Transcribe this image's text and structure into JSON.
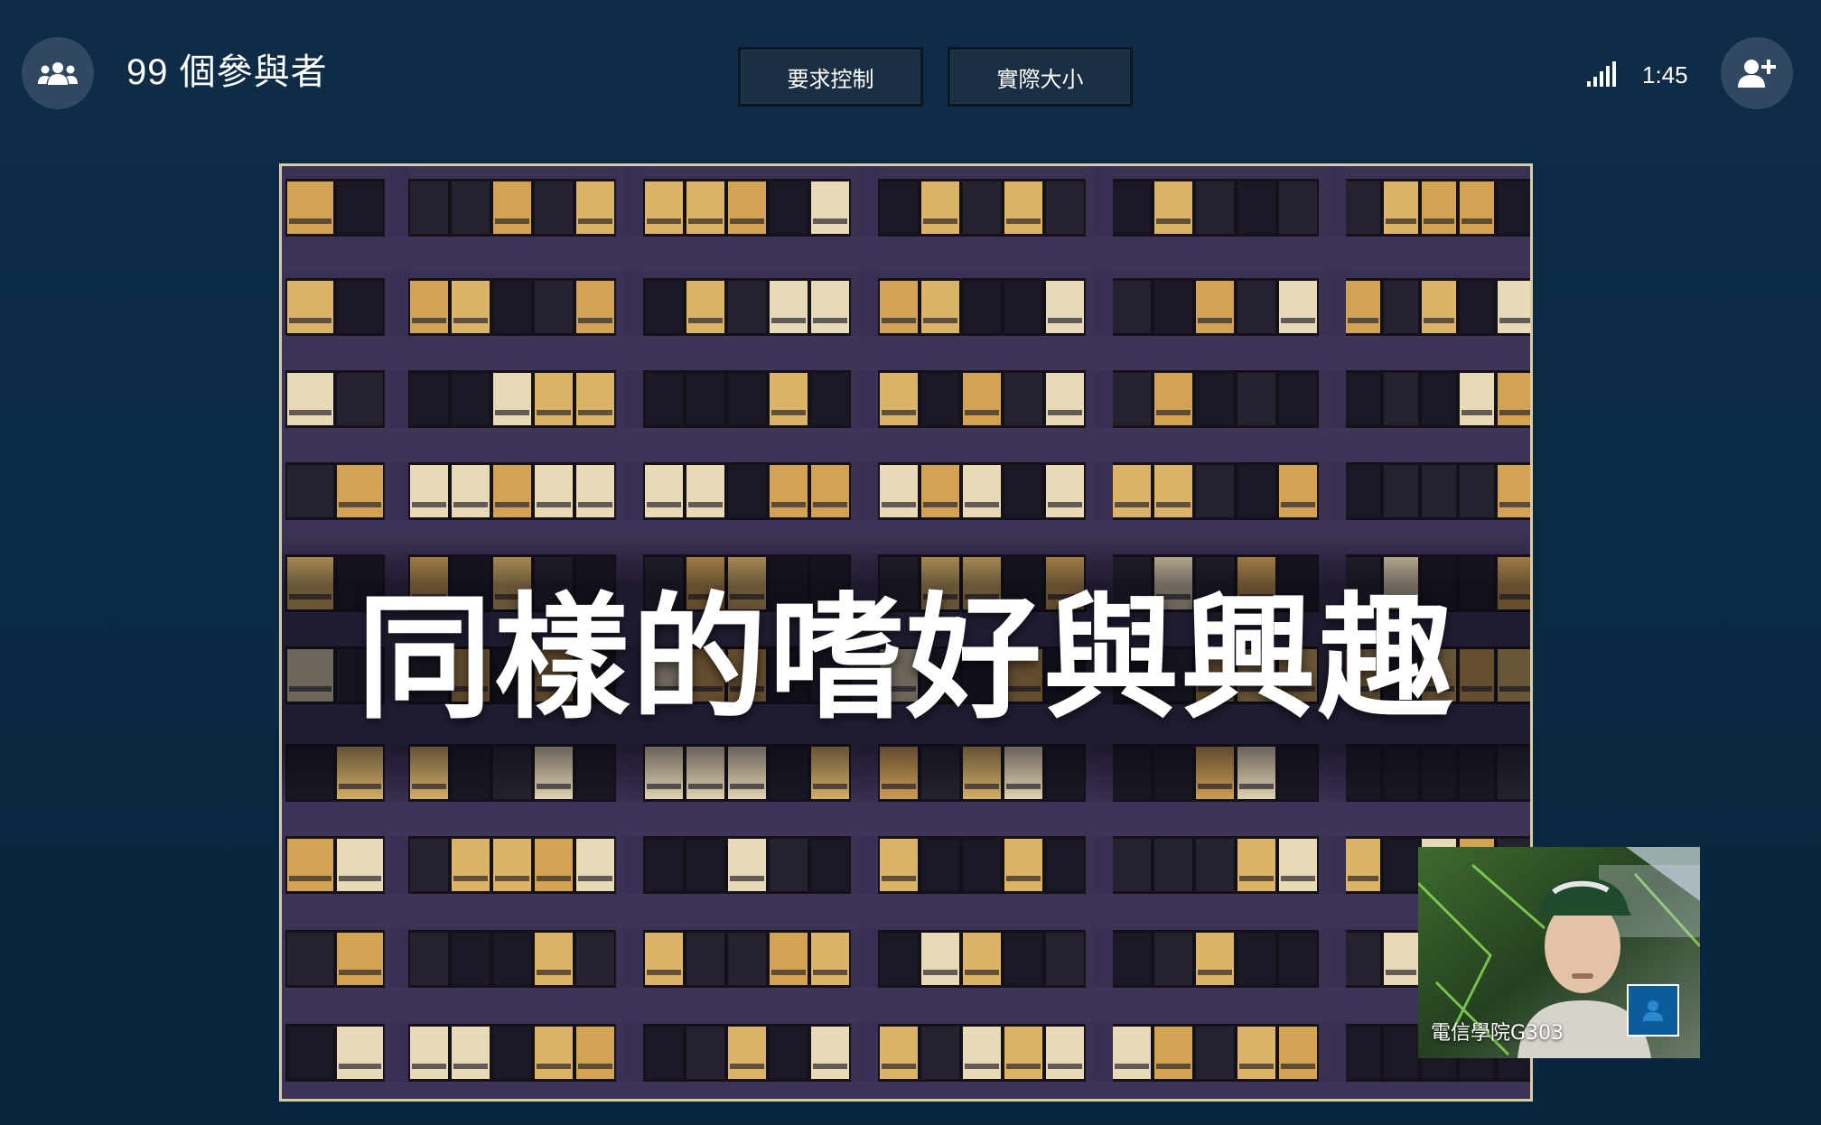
{
  "header": {
    "participants_label": "99 個參與者",
    "request_control_label": "要求控制",
    "actual_size_label": "實際大小",
    "call_time": "1:45"
  },
  "icons": {
    "participants": "people-group-icon",
    "signal": "signal-strength-icon",
    "add_person": "add-person-icon",
    "avatar": "person-icon"
  },
  "shared_screen": {
    "slide_title": "同樣的嗜好與興趣"
  },
  "self_video": {
    "name": "電信學院G303"
  },
  "colors": {
    "background": "#0b2a44",
    "button": "#1a2f43",
    "avatar_badge": "#0a5d9a",
    "screen_border": "#d8cfa0"
  }
}
